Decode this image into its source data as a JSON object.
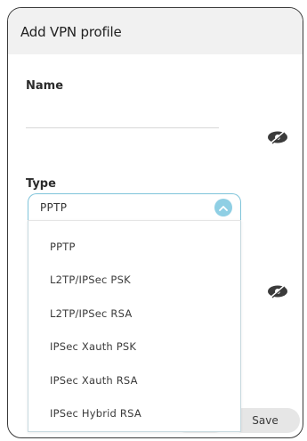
{
  "dialog": {
    "title": "Add VPN profile"
  },
  "name_field": {
    "label": "Name",
    "value": "",
    "placeholder": ""
  },
  "type_field": {
    "label": "Type",
    "selected": "PPTP",
    "options": [
      "PPTP",
      "L2TP/IPSec PSK",
      "L2TP/IPSec RSA",
      "IPSec Xauth PSK",
      "IPSec Xauth RSA",
      "IPSec Hybrid RSA"
    ]
  },
  "footer": {
    "save_label": "Save"
  },
  "icons": {
    "visibility_1": "eye-off-icon",
    "visibility_2": "eye-off-icon",
    "dropdown_toggle": "chevron-up-icon"
  },
  "colors": {
    "accent": "#8fcfe4",
    "header_bg": "#f1f1f1",
    "dropdown_border": "#7fc4da"
  }
}
